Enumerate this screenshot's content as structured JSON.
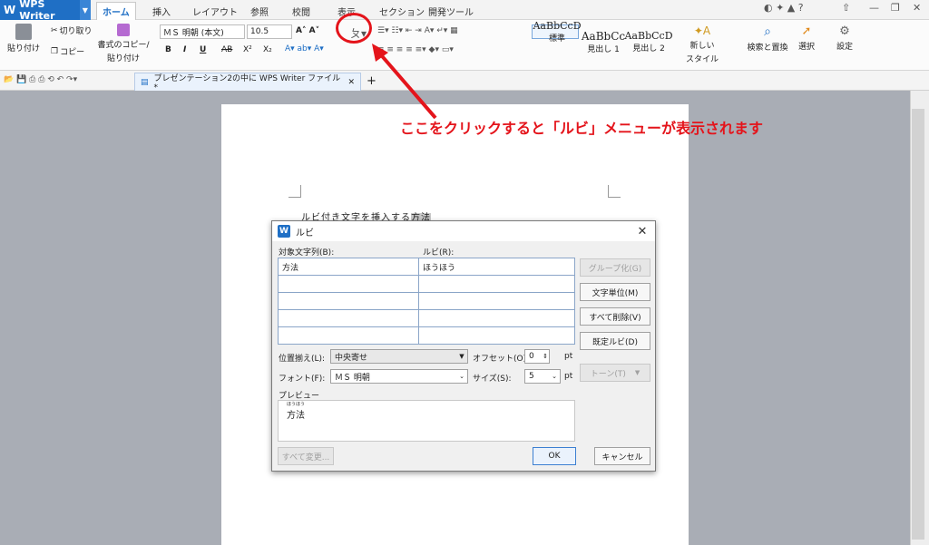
{
  "app": {
    "name": "WPS Writer",
    "logo": "W"
  },
  "tabs": [
    "ホーム",
    "挿入",
    "レイアウト",
    "参照",
    "校閲",
    "表示",
    "セクション",
    "開発ツール"
  ],
  "ribbon": {
    "paste": "貼り付け",
    "cut": "切り取り",
    "copy": "コピー",
    "format_painter_1": "書式のコピー/",
    "format_painter_2": "貼り付け",
    "font_name": "ＭＳ 明朝 (本文)",
    "font_size": "10.5",
    "bold": "B",
    "italic": "I",
    "underline": "U",
    "strike": "AB",
    "superscript": "X²",
    "subscript": "X₂",
    "styles": [
      {
        "sample": "AaBbCcD",
        "name": "標準"
      },
      {
        "sample": "AaBbCc",
        "name": "見出し 1"
      },
      {
        "sample": "AaBbCcD",
        "name": "見出し 2"
      }
    ],
    "new_style_1": "新しい",
    "new_style_2": "スタイル",
    "find_replace": "検索と置換",
    "select": "選択",
    "settings": "設定"
  },
  "doc_tab": "プレゼンテーション2の中に WPS Writer ファイル *",
  "doc_text_pre": "ルビ付き文字を挿入する",
  "doc_text_hl": "方法",
  "callout": "ここをクリックすると「ルビ」メニューが表示されます",
  "dialog": {
    "title": "ルビ",
    "col_target": "対象文字列(B):",
    "col_ruby": "ルビ(R):",
    "rows": [
      {
        "target": "方法",
        "ruby": "ほうほう"
      },
      {
        "target": "",
        "ruby": ""
      },
      {
        "target": "",
        "ruby": ""
      },
      {
        "target": "",
        "ruby": ""
      },
      {
        "target": "",
        "ruby": ""
      }
    ],
    "btn_group": "グループ化(G)",
    "btn_char": "文字単位(M)",
    "btn_clear": "すべて削除(V)",
    "btn_default": "既定ルビ(D)",
    "btn_tone": "トーン(T)",
    "align_label": "位置揃え(L):",
    "align_value": "中央寄せ",
    "offset_label": "オフセット(O):",
    "offset_value": "0",
    "unit_pt": "pt",
    "font_label": "フォント(F):",
    "font_value": "ＭＳ 明朝",
    "size_label": "サイズ(S):",
    "size_value": "5",
    "preview_label": "プレビュー",
    "preview_ruby": "ほうほう",
    "preview_text": "方法",
    "btn_apply_all": "すべて変更...",
    "btn_ok": "OK",
    "btn_cancel": "キャンセル"
  },
  "colors": {
    "accent": "#1f6fc5",
    "callout": "#e4141b"
  }
}
